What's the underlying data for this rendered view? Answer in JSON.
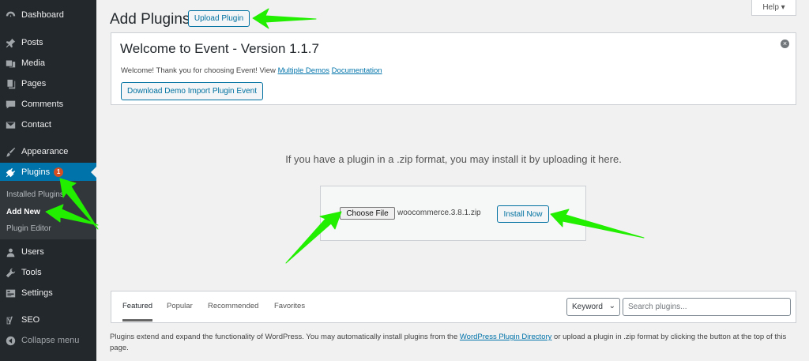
{
  "sidebar": {
    "items": [
      {
        "label": "Dashboard",
        "icon": "dashboard-icon"
      },
      {
        "label": "Posts",
        "icon": "pin-icon"
      },
      {
        "label": "Media",
        "icon": "media-icon"
      },
      {
        "label": "Pages",
        "icon": "pages-icon"
      },
      {
        "label": "Comments",
        "icon": "comments-icon"
      },
      {
        "label": "Contact",
        "icon": "mail-icon"
      },
      {
        "label": "Appearance",
        "icon": "brush-icon"
      },
      {
        "label": "Plugins",
        "icon": "plugin-icon",
        "badge": "1"
      },
      {
        "label": "Users",
        "icon": "users-icon"
      },
      {
        "label": "Tools",
        "icon": "wrench-icon"
      },
      {
        "label": "Settings",
        "icon": "settings-icon"
      },
      {
        "label": "SEO",
        "icon": "yoast-icon"
      },
      {
        "label": "Collapse menu",
        "icon": "collapse-icon"
      }
    ],
    "submenu": [
      {
        "label": "Installed Plugins"
      },
      {
        "label": "Add New"
      },
      {
        "label": "Plugin Editor"
      }
    ]
  },
  "header": {
    "title": "Add Plugins",
    "upload_button": "Upload Plugin",
    "help_tab": "Help ▾"
  },
  "notice": {
    "title": "Welcome to Event - Version 1.1.7",
    "text_prefix": "Welcome! Thank you for choosing Event! View ",
    "link_demos": "Multiple Demos",
    "link_docs": "Documentation",
    "demo_button": "Download Demo Import Plugin Event",
    "dismiss": "×"
  },
  "upload": {
    "instructions": "If you have a plugin in a .zip format, you may install it by uploading it here.",
    "choose_file": "Choose File",
    "file_name": "woocommerce.3.8.1.zip",
    "install_button": "Install Now"
  },
  "filter": {
    "tabs": [
      "Featured",
      "Popular",
      "Recommended",
      "Favorites"
    ],
    "search_type": "Keyword",
    "search_placeholder": "Search plugins..."
  },
  "footer": {
    "text_prefix": "Plugins extend and expand the functionality of WordPress. You may automatically install plugins from the ",
    "link": "WordPress Plugin Directory",
    "text_suffix": " or upload a plugin in .zip format by clicking the button at the top of this page."
  },
  "colors": {
    "sidebar_bg": "#23282d",
    "active": "#0073aa",
    "annotation_arrow": "#22ee00"
  }
}
